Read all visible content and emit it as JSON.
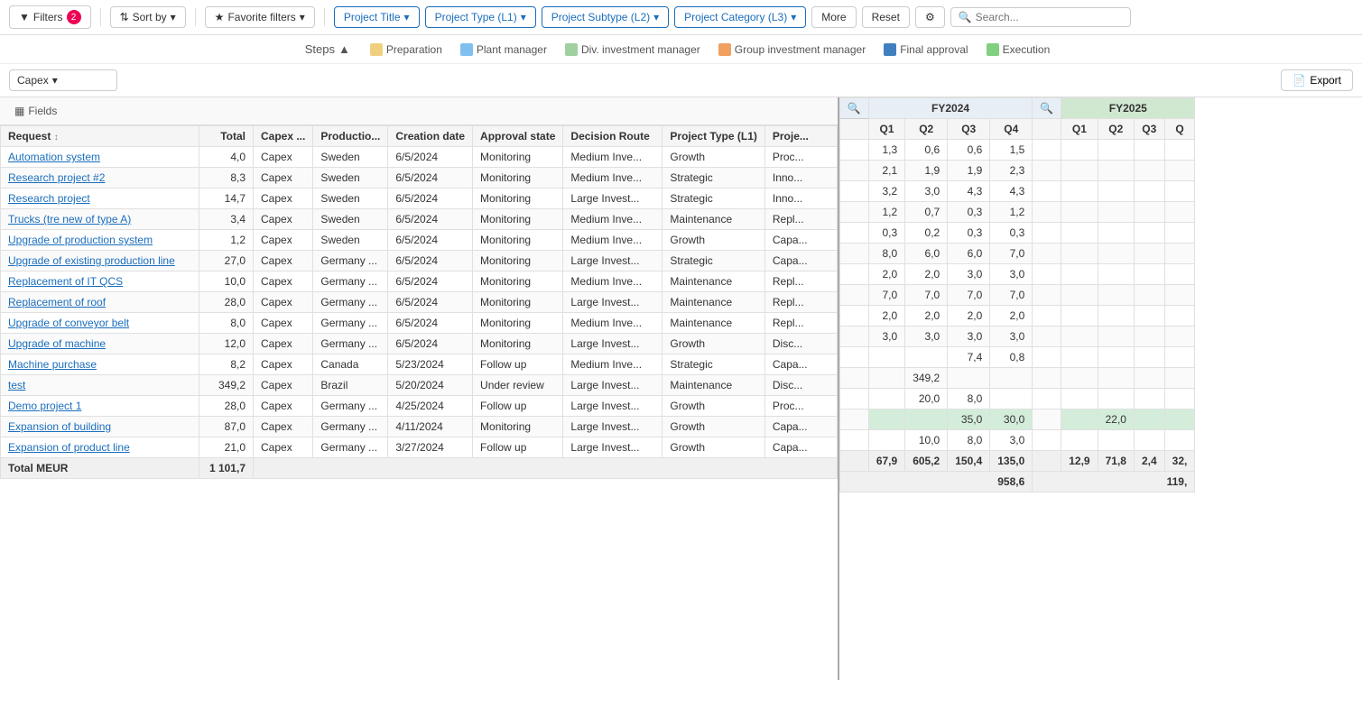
{
  "toolbar": {
    "filters_label": "Filters",
    "filters_count": "2",
    "sort_label": "Sort by",
    "favorites_label": "Favorite filters",
    "project_title_label": "Project Title",
    "project_type_label": "Project Type (L1)",
    "project_subtype_label": "Project Subtype (L2)",
    "project_category_label": "Project Category (L3)",
    "more_label": "More",
    "reset_label": "Reset",
    "search_placeholder": "Search..."
  },
  "steps": {
    "title": "Steps",
    "items": [
      {
        "label": "Preparation",
        "color_class": "dot-preparation"
      },
      {
        "label": "Plant manager",
        "color_class": "dot-plant"
      },
      {
        "label": "Div. investment manager",
        "color_class": "dot-div"
      },
      {
        "label": "Group investment manager",
        "color_class": "dot-group"
      },
      {
        "label": "Final approval",
        "color_class": "dot-final"
      },
      {
        "label": "Execution",
        "color_class": "dot-execution"
      }
    ]
  },
  "subtoolbar": {
    "capex_value": "Capex",
    "export_label": "Export"
  },
  "table": {
    "fields_label": "Fields",
    "columns": [
      "Request",
      "Total",
      "Capex ...",
      "Productio...",
      "Creation date",
      "Approval state",
      "Decision Route",
      "Project Type (L1)",
      "Proje..."
    ],
    "fy2024_label": "FY2024",
    "fy2025_label": "FY2025",
    "quarters_2024": [
      "Q1",
      "Q2",
      "Q3",
      "Q4"
    ],
    "quarters_2025": [
      "Q1",
      "Q2",
      "Q3",
      "Q"
    ],
    "rows": [
      {
        "request": "Automation system",
        "total": "4,0",
        "capex": "Capex",
        "prod": "Sweden",
        "date": "6/5/2024",
        "approval": "Monitoring",
        "decision": "Medium Inve...",
        "type": "Growth",
        "proj": "Proc...",
        "q1_24": "1,3",
        "q2_24": "0,6",
        "q3_24": "0,6",
        "q4_24": "1,5",
        "q1_25": "",
        "q2_25": "",
        "q3_25": "",
        "q4_25": "",
        "highlight": false
      },
      {
        "request": "Research project #2",
        "total": "8,3",
        "capex": "Capex",
        "prod": "Sweden",
        "date": "6/5/2024",
        "approval": "Monitoring",
        "decision": "Medium Inve...",
        "type": "Strategic",
        "proj": "Inno...",
        "q1_24": "2,1",
        "q2_24": "1,9",
        "q3_24": "1,9",
        "q4_24": "2,3",
        "q1_25": "",
        "q2_25": "",
        "q3_25": "",
        "q4_25": "",
        "highlight": false
      },
      {
        "request": "Research project",
        "total": "14,7",
        "capex": "Capex",
        "prod": "Sweden",
        "date": "6/5/2024",
        "approval": "Monitoring",
        "decision": "Large Invest...",
        "type": "Strategic",
        "proj": "Inno...",
        "q1_24": "3,2",
        "q2_24": "3,0",
        "q3_24": "4,3",
        "q4_24": "4,3",
        "q1_25": "",
        "q2_25": "",
        "q3_25": "",
        "q4_25": "",
        "highlight": false
      },
      {
        "request": "Trucks (tre new of type A)",
        "total": "3,4",
        "capex": "Capex",
        "prod": "Sweden",
        "date": "6/5/2024",
        "approval": "Monitoring",
        "decision": "Medium Inve...",
        "type": "Maintenance",
        "proj": "Repl...",
        "q1_24": "1,2",
        "q2_24": "0,7",
        "q3_24": "0,3",
        "q4_24": "1,2",
        "q1_25": "",
        "q2_25": "",
        "q3_25": "",
        "q4_25": "",
        "highlight": false
      },
      {
        "request": "Upgrade of production system",
        "total": "1,2",
        "capex": "Capex",
        "prod": "Sweden",
        "date": "6/5/2024",
        "approval": "Monitoring",
        "decision": "Medium Inve...",
        "type": "Growth",
        "proj": "Capa...",
        "q1_24": "0,3",
        "q2_24": "0,2",
        "q3_24": "0,3",
        "q4_24": "0,3",
        "q1_25": "",
        "q2_25": "",
        "q3_25": "",
        "q4_25": "",
        "highlight": false
      },
      {
        "request": "Upgrade of existing production line",
        "total": "27,0",
        "capex": "Capex",
        "prod": "Germany ...",
        "date": "6/5/2024",
        "approval": "Monitoring",
        "decision": "Large Invest...",
        "type": "Strategic",
        "proj": "Capa...",
        "q1_24": "8,0",
        "q2_24": "6,0",
        "q3_24": "6,0",
        "q4_24": "7,0",
        "q1_25": "",
        "q2_25": "",
        "q3_25": "",
        "q4_25": "",
        "highlight": false
      },
      {
        "request": "Replacement of IT QCS",
        "total": "10,0",
        "capex": "Capex",
        "prod": "Germany ...",
        "date": "6/5/2024",
        "approval": "Monitoring",
        "decision": "Medium Inve...",
        "type": "Maintenance",
        "proj": "Repl...",
        "q1_24": "2,0",
        "q2_24": "2,0",
        "q3_24": "3,0",
        "q4_24": "3,0",
        "q1_25": "",
        "q2_25": "",
        "q3_25": "",
        "q4_25": "",
        "highlight": false
      },
      {
        "request": "Replacement of roof",
        "total": "28,0",
        "capex": "Capex",
        "prod": "Germany ...",
        "date": "6/5/2024",
        "approval": "Monitoring",
        "decision": "Large Invest...",
        "type": "Maintenance",
        "proj": "Repl...",
        "q1_24": "7,0",
        "q2_24": "7,0",
        "q3_24": "7,0",
        "q4_24": "7,0",
        "q1_25": "",
        "q2_25": "",
        "q3_25": "",
        "q4_25": "",
        "highlight": false
      },
      {
        "request": "Upgrade of conveyor belt",
        "total": "8,0",
        "capex": "Capex",
        "prod": "Germany ...",
        "date": "6/5/2024",
        "approval": "Monitoring",
        "decision": "Medium Inve...",
        "type": "Maintenance",
        "proj": "Repl...",
        "q1_24": "2,0",
        "q2_24": "2,0",
        "q3_24": "2,0",
        "q4_24": "2,0",
        "q1_25": "",
        "q2_25": "",
        "q3_25": "",
        "q4_25": "",
        "highlight": false
      },
      {
        "request": "Upgrade of machine",
        "total": "12,0",
        "capex": "Capex",
        "prod": "Germany ...",
        "date": "6/5/2024",
        "approval": "Monitoring",
        "decision": "Large Invest...",
        "type": "Growth",
        "proj": "Disc...",
        "q1_24": "3,0",
        "q2_24": "3,0",
        "q3_24": "3,0",
        "q4_24": "3,0",
        "q1_25": "",
        "q2_25": "",
        "q3_25": "",
        "q4_25": "",
        "highlight": false
      },
      {
        "request": "Machine purchase",
        "total": "8,2",
        "capex": "Capex",
        "prod": "Canada",
        "date": "5/23/2024",
        "approval": "Follow up",
        "decision": "Medium Inve...",
        "type": "Strategic",
        "proj": "Capa...",
        "q1_24": "",
        "q2_24": "",
        "q3_24": "7,4",
        "q4_24": "0,8",
        "q1_25": "",
        "q2_25": "",
        "q3_25": "",
        "q4_25": "",
        "highlight": false
      },
      {
        "request": "test",
        "total": "349,2",
        "capex": "Capex",
        "prod": "Brazil",
        "date": "5/20/2024",
        "approval": "Under review",
        "decision": "Large Invest...",
        "type": "Maintenance",
        "proj": "Disc...",
        "q1_24": "",
        "q2_24": "349,2",
        "q3_24": "",
        "q4_24": "",
        "q1_25": "",
        "q2_25": "",
        "q3_25": "",
        "q4_25": "",
        "highlight": false
      },
      {
        "request": "Demo project 1",
        "total": "28,0",
        "capex": "Capex",
        "prod": "Germany ...",
        "date": "4/25/2024",
        "approval": "Follow up",
        "decision": "Large Invest...",
        "type": "Growth",
        "proj": "Proc...",
        "q1_24": "",
        "q2_24": "20,0",
        "q3_24": "8,0",
        "q4_24": "",
        "q1_25": "",
        "q2_25": "",
        "q3_25": "",
        "q4_25": "",
        "highlight": false
      },
      {
        "request": "Expansion of building",
        "total": "87,0",
        "capex": "Capex",
        "prod": "Germany ...",
        "date": "4/11/2024",
        "approval": "Monitoring",
        "decision": "Large Invest...",
        "type": "Growth",
        "proj": "Capa...",
        "q1_24": "",
        "q2_24": "",
        "q3_24": "35,0",
        "q4_24": "30,0",
        "q1_25": "",
        "q2_25": "22,0",
        "q3_25": "",
        "q4_25": "",
        "highlight": true
      },
      {
        "request": "Expansion of product line",
        "total": "21,0",
        "capex": "Capex",
        "prod": "Germany ...",
        "date": "3/27/2024",
        "approval": "Follow up",
        "decision": "Large Invest...",
        "type": "Growth",
        "proj": "Capa...",
        "q1_24": "",
        "q2_24": "10,0",
        "q3_24": "8,0",
        "q4_24": "3,0",
        "q1_25": "",
        "q2_25": "",
        "q3_25": "",
        "q4_25": "",
        "highlight": false
      }
    ],
    "totals": {
      "label": "Total MEUR",
      "total": "1 101,7",
      "q1_24": "67,9",
      "q2_24": "605,2",
      "q3_24": "150,4",
      "q4_24": "135,0",
      "q1_25": "12,9",
      "q2_25": "71,8",
      "q3_25": "2,4",
      "q4_25": "32,",
      "sub1": "958,6",
      "sub2": "119,"
    }
  }
}
